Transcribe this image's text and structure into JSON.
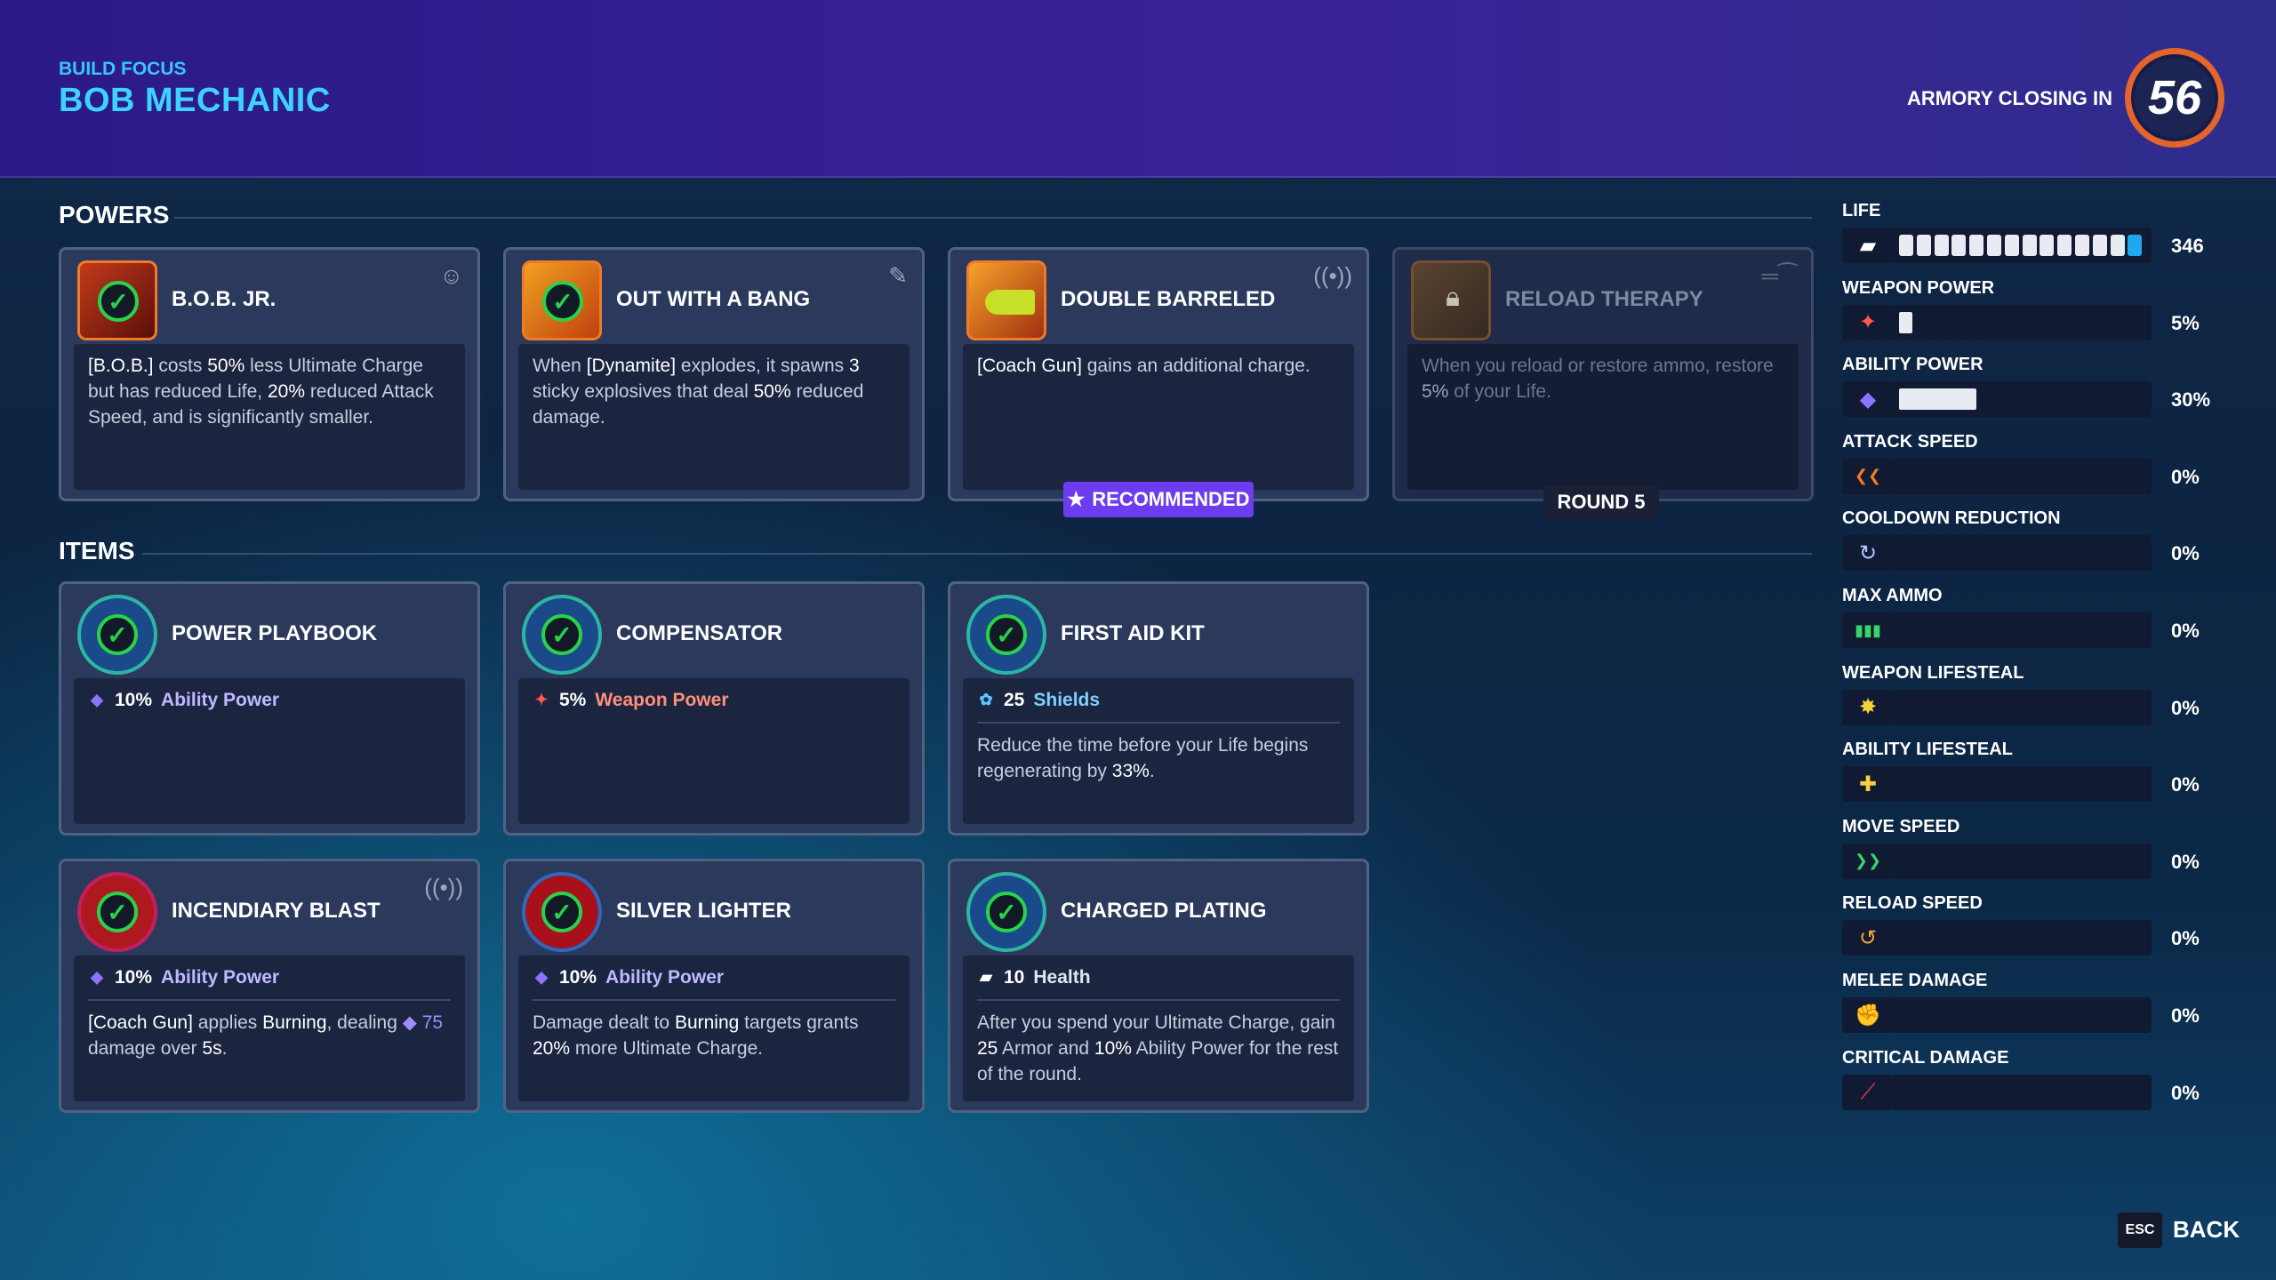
{
  "header": {
    "build_label": "BUILD FOCUS",
    "build_title": "BOB MECHANIC",
    "closing_label": "ARMORY CLOSING IN",
    "timer": "56"
  },
  "powers": {
    "section_title": "POWERS",
    "cards": [
      {
        "title": "B.O.B. JR.",
        "corner_icon": "bob-icon",
        "desc_html": "<b>[B.O.B.]</b> costs <b>50%</b> less Ultimate Charge but has reduced Life, <b>20%</b> reduced Attack Speed, and is significantly smaller."
      },
      {
        "title": "OUT WITH A BANG",
        "corner_icon": "dynamite-icon",
        "desc_html": "When <b>[Dynamite]</b> explodes, it spawns <b>3</b> sticky explosives that deal <b>50%</b> reduced damage."
      },
      {
        "title": "DOUBLE BARRELED",
        "corner_icon": "signal-icon",
        "desc_html": "<b>[Coach Gun]</b> gains an additional charge.",
        "badge": "RECOMMENDED"
      },
      {
        "title": "RELOAD THERAPY",
        "corner_icon": "rifle-icon",
        "desc_html": "When you reload or restore ammo, restore <b>5%</b> of your Life.",
        "badge": "ROUND 5",
        "locked": true
      }
    ]
  },
  "items": {
    "section_title": "ITEMS",
    "cards": [
      {
        "title": "POWER PLAYBOOK",
        "stat_value": "10%",
        "stat_name": "Ability Power",
        "stat_icon": "ability-power-icon",
        "desc_html": ""
      },
      {
        "title": "COMPENSATOR",
        "stat_value": "5%",
        "stat_name": "Weapon Power",
        "stat_icon": "weapon-power-icon",
        "desc_html": ""
      },
      {
        "title": "FIRST AID KIT",
        "stat_value": "25",
        "stat_name": "Shields",
        "stat_icon": "shields-icon",
        "desc_html": "Reduce the time before your Life begins regenerating by <b>33%</b>."
      },
      {
        "title": "INCENDIARY BLAST",
        "stat_value": "10%",
        "stat_name": "Ability Power",
        "stat_icon": "ability-power-icon",
        "desc_html": "<b>[Coach Gun]</b> applies <b>Burning</b>, dealing <span style=\"color:#9d8cff\">&#9670; 75</span> damage over <b>5s</b>.",
        "corner_icon": "signal-icon"
      },
      {
        "title": "SILVER LIGHTER",
        "stat_value": "10%",
        "stat_name": "Ability Power",
        "stat_icon": "ability-power-icon",
        "desc_html": "Damage dealt to <b>Burning</b> targets grants <b>20%</b> more Ultimate Charge."
      },
      {
        "title": "CHARGED PLATING",
        "stat_value": "10",
        "stat_name": "Health",
        "stat_icon": "health-icon",
        "desc_html": "After you spend your Ultimate Charge, gain <b>25</b> Armor and <b>10%</b> Ability Power for the rest of the round."
      }
    ]
  },
  "stats": [
    {
      "label": "LIFE",
      "value": "346",
      "icon": "health-icon",
      "fill": 1.0,
      "segments": 14
    },
    {
      "label": "WEAPON POWER",
      "value": "5%",
      "icon": "weapon-power-icon",
      "fill": 0.05
    },
    {
      "label": "ABILITY POWER",
      "value": "30%",
      "icon": "ability-power-icon",
      "fill": 0.3
    },
    {
      "label": "ATTACK SPEED",
      "value": "0%",
      "icon": "attack-speed-icon",
      "fill": 0
    },
    {
      "label": "COOLDOWN REDUCTION",
      "value": "0%",
      "icon": "cooldown-icon",
      "fill": 0
    },
    {
      "label": "MAX AMMO",
      "value": "0%",
      "icon": "ammo-icon",
      "fill": 0
    },
    {
      "label": "WEAPON LIFESTEAL",
      "value": "0%",
      "icon": "weapon-lifesteal-icon",
      "fill": 0
    },
    {
      "label": "ABILITY LIFESTEAL",
      "value": "0%",
      "icon": "ability-lifesteal-icon",
      "fill": 0
    },
    {
      "label": "MOVE SPEED",
      "value": "0%",
      "icon": "move-speed-icon",
      "fill": 0
    },
    {
      "label": "RELOAD SPEED",
      "value": "0%",
      "icon": "reload-speed-icon",
      "fill": 0
    },
    {
      "label": "MELEE DAMAGE",
      "value": "0%",
      "icon": "melee-icon",
      "fill": 0
    },
    {
      "label": "CRITICAL DAMAGE",
      "value": "0%",
      "icon": "critical-icon",
      "fill": 0
    }
  ],
  "footer": {
    "esc_key": "ESC",
    "back_label": "BACK"
  },
  "colors": {
    "accent": "#3ed2ff",
    "recommended": "#6d3cf0",
    "timer_ring": "#e5642a",
    "check": "#29d24a"
  }
}
